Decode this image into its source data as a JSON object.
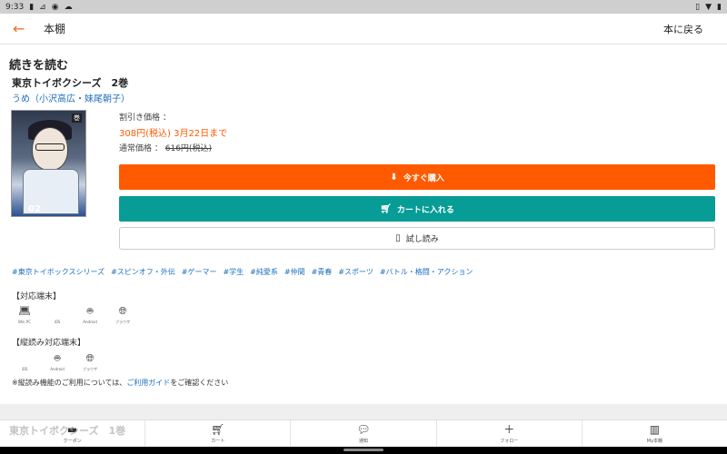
{
  "status_bar": {
    "time": "9:33",
    "icons_left": [
      "sim-icon",
      "signal-icon",
      "circle-icon",
      "cloud-icon"
    ],
    "icons_right": [
      "vibrate-icon",
      "wifi-icon",
      "battery-icon"
    ]
  },
  "appbar": {
    "title": "本棚",
    "back_to_shelf": "本に戻る"
  },
  "section_title": "続きを読む",
  "book": {
    "title": "東京トイボクシーズ　2巻",
    "author": "うめ（小沢高広・妹尾朝子）",
    "cover_badge": "巻",
    "cover_volume": "02"
  },
  "price": {
    "discount_label": "割引き価格 ：",
    "sale": "308円(税込)",
    "sale_until": "3月22日まで",
    "regular_label": "通常価格 ：",
    "regular_value": "616円(税込)"
  },
  "buttons": {
    "buy": "今すぐ購入",
    "cart": "カートに入れる",
    "trial": "試し読み"
  },
  "tags": [
    "#東京トイボックスシリーズ",
    "#スピンオフ・外伝",
    "#ゲーマー",
    "#学生",
    "#純愛系",
    "#仲間",
    "#青春",
    "#スポーツ",
    "#バトル・格闘・アクション"
  ],
  "support": {
    "title": "【対応端末】",
    "devices": [
      {
        "icon": "laptop-icon",
        "label": "Win PC"
      },
      {
        "icon": "apple-icon",
        "label": "iOS"
      },
      {
        "icon": "android-icon",
        "label": "Android"
      },
      {
        "icon": "globe-icon",
        "label": "ブラウザ"
      }
    ]
  },
  "vertical_support": {
    "title": "【縦読み対応端末】",
    "devices": [
      {
        "icon": "apple-icon",
        "label": "iOS"
      },
      {
        "icon": "android-icon",
        "label": "Android"
      },
      {
        "icon": "globe-icon",
        "label": "ブラウザ"
      }
    ]
  },
  "note": {
    "prefix": "※縦読み機能のご利用については、",
    "link": "ご利用ガイド",
    "suffix": "をご確認ください"
  },
  "ghost_title": "東京トイボクシーズ　1巻",
  "bottom_nav": [
    {
      "icon": "coupon-icon",
      "label": "クーポン"
    },
    {
      "icon": "cart-icon",
      "label": "カート"
    },
    {
      "icon": "notice-icon",
      "label": "通知"
    },
    {
      "icon": "plus-icon",
      "label": "フォロー"
    },
    {
      "icon": "bookshelf-icon",
      "label": "My本棚"
    }
  ],
  "colors": {
    "accent": "#ff5a00",
    "cart": "#079c96",
    "link": "#1e6fbf",
    "back": "#f06a1c"
  }
}
